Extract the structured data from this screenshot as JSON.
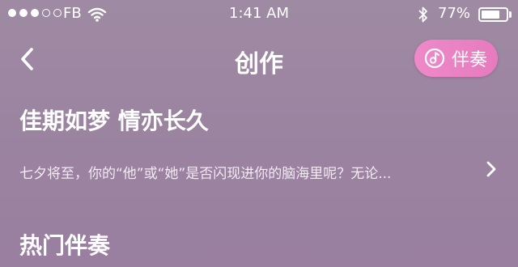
{
  "status_bar": {
    "carrier": "FB",
    "time": "1:41 AM",
    "battery_percent": "77%",
    "battery_level": 0.77,
    "signal_dots_filled": 3,
    "signal_dots_total": 5
  },
  "nav": {
    "title": "创作",
    "accompaniment_button_label": "伴奏"
  },
  "topic": {
    "title": "佳期如梦 情亦长久",
    "description": "七夕将至，你的“他”或“她”是否闪现进你的脑海里呢？无论..."
  },
  "sections": {
    "hot_accompaniment_title": "热门伴奏"
  },
  "colors": {
    "background": "#9c86a1",
    "accent_pink": "#ea82c3",
    "text": "#ffffff"
  },
  "icons": [
    "back-chevron-icon",
    "music-note-icon",
    "chevron-right-icon",
    "wifi-icon",
    "bluetooth-icon",
    "battery-icon"
  ]
}
